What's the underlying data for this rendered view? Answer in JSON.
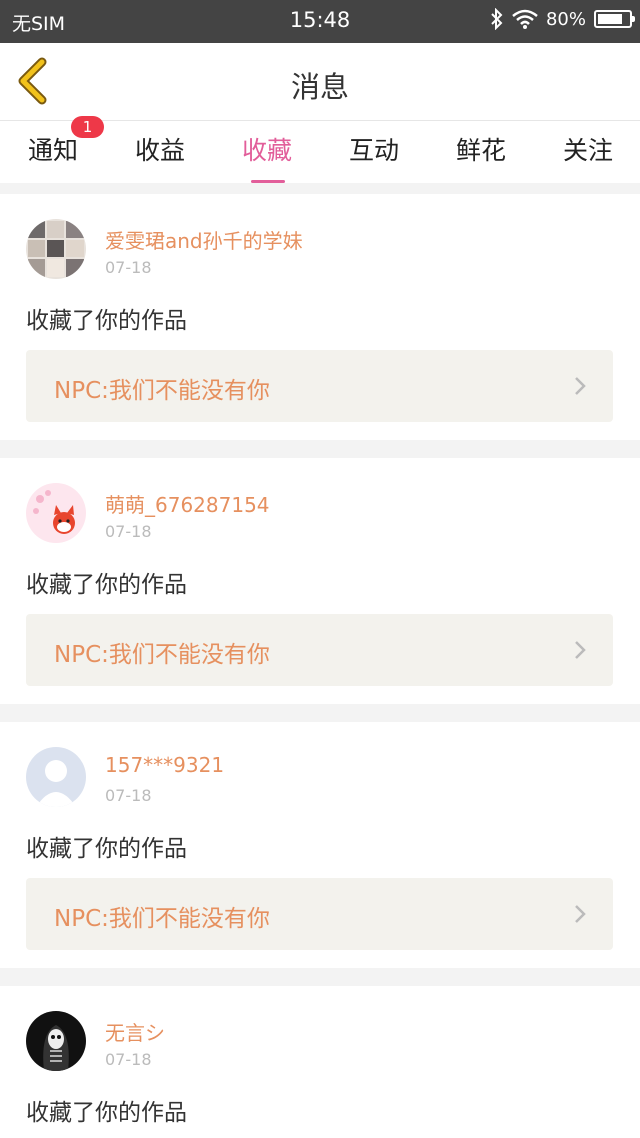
{
  "status_bar": {
    "carrier": "无SIM",
    "time": "15:48",
    "battery": "80%",
    "battery_level": 0.8,
    "icons": [
      "bluetooth-icon",
      "wifi-icon",
      "battery-icon"
    ]
  },
  "header": {
    "title": "消息",
    "back_icon": "chevron-left-icon",
    "back_color": "#f2c21b"
  },
  "tabs": [
    {
      "label": "通知",
      "badge": "1"
    },
    {
      "label": "收益"
    },
    {
      "label": "收藏",
      "active": true
    },
    {
      "label": "互动"
    },
    {
      "label": "鲜花"
    },
    {
      "label": "关注"
    }
  ],
  "colors": {
    "accent": "#e25e9a",
    "name": "#e6905f",
    "badge": "#ee3848"
  },
  "messages": [
    {
      "username": "爱雯珺and孙千的学妹",
      "date": "07-18",
      "action": "收藏了你的作品",
      "work": "NPC:我们不能没有你",
      "avatar": "photo-collage-avatar"
    },
    {
      "username": "萌萌_676287154",
      "date": "07-18",
      "action": "收藏了你的作品",
      "work": "NPC:我们不能没有你",
      "avatar": "red-fox-avatar"
    },
    {
      "username": "157***9321",
      "date": "07-18",
      "action": "收藏了你的作品",
      "work": "NPC:我们不能没有你",
      "avatar": "default-user-avatar"
    },
    {
      "username": "无言シ",
      "date": "07-18",
      "action": "收藏了你的作品",
      "work": "",
      "avatar": "skull-hood-avatar"
    }
  ]
}
